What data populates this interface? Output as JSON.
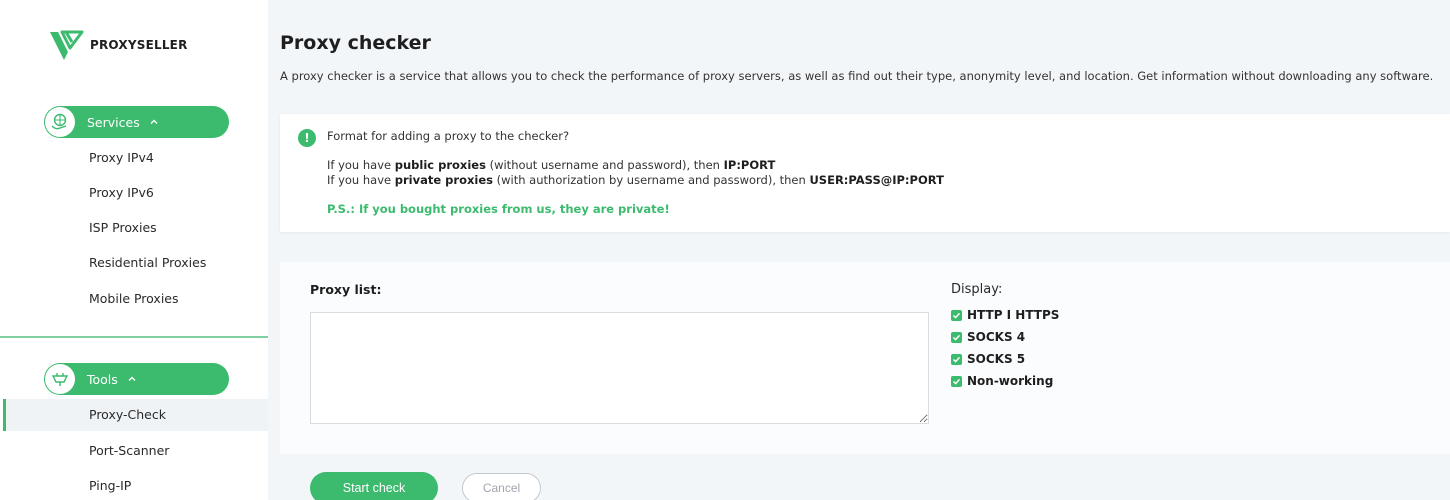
{
  "brand": {
    "name": "PROXYSELLER"
  },
  "sidebar": {
    "services": {
      "label": "Services",
      "items": [
        "Proxy IPv4",
        "Proxy IPv6",
        "ISP Proxies",
        "Residential Proxies",
        "Mobile Proxies"
      ]
    },
    "tools": {
      "label": "Tools",
      "items": [
        "Proxy-Check",
        "Port-Scanner",
        "Ping-IP"
      ],
      "active": "Proxy-Check"
    }
  },
  "main": {
    "title": "Proxy checker",
    "description": "A proxy checker is a service that allows you to check the performance of proxy servers, as well as find out their type, anonymity level, and location. Get information without downloading any software."
  },
  "info": {
    "heading": "Format for adding a proxy to the checker?",
    "public_prefix": "If you have ",
    "public_bold": "public proxies",
    "public_mid": " (without username and password), then ",
    "public_format": "IP:PORT",
    "private_prefix": "If you have ",
    "private_bold": "private proxies",
    "private_mid": " (with authorization by username and password), then ",
    "private_format": "USER:PASS@IP:PORT",
    "ps": "P.S.: If you bought proxies from us, they are private!"
  },
  "form": {
    "proxy_list_label": "Proxy list:",
    "proxy_list_value": "",
    "display_label": "Display:",
    "options": [
      {
        "label": "HTTP I HTTPS",
        "checked": true
      },
      {
        "label": "SOCKS 4",
        "checked": true
      },
      {
        "label": "SOCKS 5",
        "checked": true
      },
      {
        "label": "Non-working",
        "checked": true
      }
    ],
    "start_label": "Start check",
    "cancel_label": "Cancel"
  },
  "colors": {
    "accent": "#3cba6e",
    "background": "#f3f6f9",
    "sidebar": "#ffffff"
  },
  "icons": {
    "info": "exclamation-icon",
    "check": "check-icon",
    "chevron": "chevron-up-icon"
  }
}
